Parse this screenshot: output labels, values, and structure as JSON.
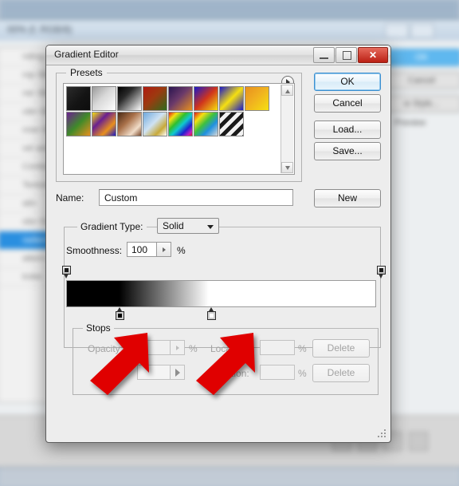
{
  "background": {
    "window_title": "00% (f, RGB/8)",
    "sidebar_items": [
      "nding Options",
      "rop Shadow",
      "ner Shadow",
      "uter Glow",
      "nner Glow",
      "vel and Emboss",
      "Contour",
      "Texture",
      "atin",
      "olor Overlay",
      "radient Overlay",
      "attern Overlay",
      "troke"
    ],
    "selected_sidebar_index": 10,
    "buttons": [
      "OK",
      "Cancel",
      "w Style...",
      "Preview"
    ]
  },
  "dialog": {
    "title": "Gradient Editor",
    "window_buttons": {
      "minimize": "minimize-button",
      "maximize": "maximize-button",
      "close": "✕"
    },
    "presets": {
      "legend": "Presets",
      "swatches": [
        {
          "name": "black-dark",
          "css": "linear-gradient(135deg,#2b2b2b 0%,#141414 55%,#0d0d0d 100%)"
        },
        {
          "name": "foreground-to-transparent",
          "css": "linear-gradient(135deg,#9a9a9a 0%,#d8d8d8 45%,#ffffff 100%)"
        },
        {
          "name": "black-to-white",
          "css": "linear-gradient(135deg,#000000 0%,#2a2a2a 35%,#ffffff 100%)"
        },
        {
          "name": "red-green",
          "css": "linear-gradient(135deg,#b01b10 0%,#9c3a10 45%,#2f6b1c 100%)"
        },
        {
          "name": "violet-orange",
          "css": "linear-gradient(135deg,#2a1550 0%,#6b3a6a 45%,#e8901e 100%)"
        },
        {
          "name": "blue-red-yellow",
          "css": "linear-gradient(135deg,#1a18c8 0%,#d0351c 50%,#f5e011 100%)"
        },
        {
          "name": "blue-yellow-blue",
          "css": "linear-gradient(135deg,#1a18c8 0%,#f5e011 50%,#1a18c8 100%)"
        },
        {
          "name": "orange-yellow",
          "css": "linear-gradient(135deg,#e8901e 0%,#f0b020 45%,#f5e011 100%)"
        },
        {
          "name": "violet-green-orange",
          "css": "linear-gradient(135deg,#6a2090 0%,#3f8a2a 50%,#e8901e 100%)"
        },
        {
          "name": "yellow-violet-orange-blue",
          "css": "linear-gradient(135deg,#f5e011 0%,#6a2090 35%,#e8901e 70%,#1a18c8 100%)"
        },
        {
          "name": "copper",
          "css": "linear-gradient(135deg,#4a2a16 0%,#a9714a 40%,#f0dcc8 75%,#7a4a2c 100%)"
        },
        {
          "name": "chrome",
          "css": "linear-gradient(135deg,#6fa8dc 0%,#cfe2f3 45%,#c8a93a 75%,#ffffff 100%)"
        },
        {
          "name": "spectrum",
          "css": "linear-gradient(135deg,#e01a1a 0%,#f5e011 18%,#2fbf2f 38%,#10c8d0 55%,#2020d0 75%,#c020c0 90%,#e01a1a 100%)"
        },
        {
          "name": "transparent-rainbow",
          "css": "linear-gradient(135deg,#e01a1a 0%,#f5e011 22%,#3fc03f 45%,#2090e0 68%,#d8d8d8 100%)"
        },
        {
          "name": "transparent-stripes",
          "css": "repeating-linear-gradient(135deg,#1a1a1a 0 5px,#f2f2f2 5px 10px)"
        }
      ]
    },
    "buttons": {
      "ok": "OK",
      "cancel": "Cancel",
      "load": "Load...",
      "save": "Save...",
      "new": "New"
    },
    "name_field": {
      "label": "Name:",
      "value": "Custom"
    },
    "gradient_type": {
      "label": "Gradient Type:",
      "value": "Solid"
    },
    "smoothness": {
      "label": "Smoothness:",
      "value": "100",
      "unit": "%"
    },
    "gradient_preview": {
      "css": "linear-gradient(90deg,#000000 0%,#000000 17%,#ffffff 46%,#ffffff 100%)",
      "opacity_stops": [
        {
          "position_pct": 0,
          "name": "opacity-stop-left"
        },
        {
          "position_pct": 100,
          "name": "opacity-stop-right"
        }
      ],
      "color_stops": [
        {
          "position_pct": 17,
          "color": "#000000",
          "name": "color-stop-black"
        },
        {
          "position_pct": 46,
          "color": "#ffffff",
          "name": "color-stop-white"
        }
      ]
    },
    "stops": {
      "legend": "Stops",
      "opacity_label": "Opacity:",
      "opacity_value": "",
      "opacity_unit": "%",
      "location_label_1": "Location:",
      "location_value_1": "",
      "location_unit_1": "%",
      "delete_1": "Delete",
      "color_label": "Color:",
      "location_label_2": "Location:",
      "location_value_2": "",
      "location_unit_2": "%",
      "delete_2": "Delete"
    }
  },
  "annotations": {
    "arrows": [
      {
        "name": "arrow-pointing-to-color-stop-black",
        "color": "#e00000"
      },
      {
        "name": "arrow-pointing-to-color-stop-white",
        "color": "#e00000"
      }
    ]
  }
}
